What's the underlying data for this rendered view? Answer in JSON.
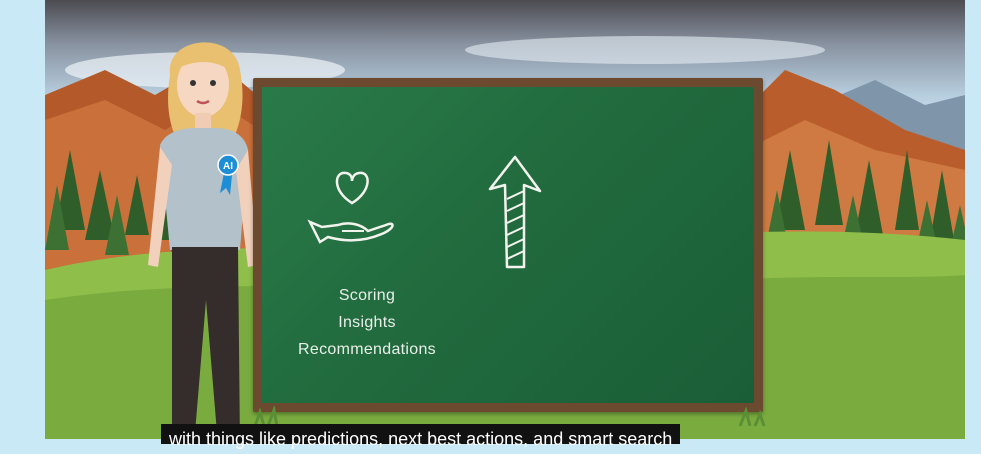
{
  "board": {
    "items": [
      "Scoring",
      "Insights",
      "Recommendations"
    ]
  },
  "character": {
    "badge": "AI"
  },
  "caption": {
    "text": "with things like predictions, next best actions, and smart search"
  },
  "icons": [
    "heart-in-hand-icon",
    "up-arrow-icon",
    "ai-badge-icon"
  ],
  "colors": {
    "board_green": "#216b3e",
    "board_frame": "#6b4a30",
    "page_background": "#c9e9f6",
    "hill_green": "#7aab3f",
    "mountain_orange": "#b45a2a"
  }
}
